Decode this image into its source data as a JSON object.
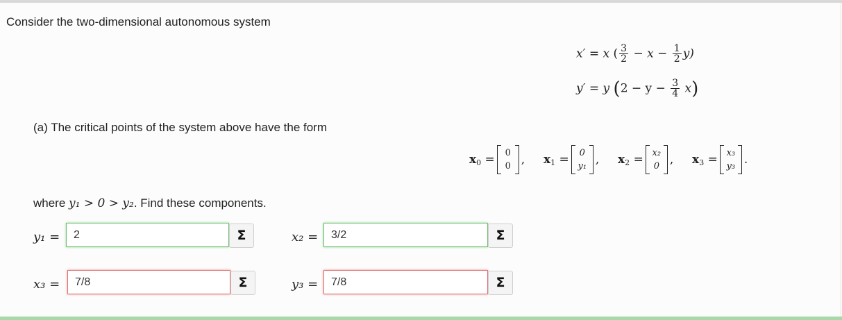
{
  "intro": "Consider the two-dimensional autonomous system",
  "part_a": "(a) The critical points of the system above have the form",
  "where_text": {
    "prefix": "where",
    "condition": "y₁ > 0 > y₂",
    "suffix": ". Find these components."
  },
  "equations": {
    "xprime": {
      "lhs": "x′ = x",
      "frac1": [
        "3",
        "2"
      ],
      "mid": "− x −",
      "frac2": [
        "1",
        "2"
      ],
      "tail": "y)"
    },
    "yprime": {
      "lhs": "y′ = y",
      "open": "(",
      "mid": "2 − y −",
      "frac": [
        "3",
        "4"
      ],
      "tail": "x",
      "close": ")"
    }
  },
  "critical_points": [
    {
      "name": "x",
      "sub": "0",
      "top": "0",
      "bottom": "0",
      "sep": ","
    },
    {
      "name": "x",
      "sub": "1",
      "top": "0",
      "bottom": "y₁",
      "sep": ","
    },
    {
      "name": "x",
      "sub": "2",
      "top": "x₂",
      "bottom": "0",
      "sep": ","
    },
    {
      "name": "x",
      "sub": "3",
      "top": "x₃",
      "bottom": "y₃",
      "sep": "."
    }
  ],
  "fields": {
    "y1": {
      "label": "y₁ =",
      "value": "2",
      "status": "correct"
    },
    "x2": {
      "label": "x₂ =",
      "value": "3/2",
      "status": "correct"
    },
    "x3": {
      "label": "x₃ =",
      "value": "7/8",
      "status": "incorrect"
    },
    "y3": {
      "label": "y₃ =",
      "value": "7/8",
      "status": "correct"
    }
  },
  "sigma_label": "Σ",
  "colors": {
    "correct": "#6fbf6f",
    "incorrect": "#e07070"
  }
}
